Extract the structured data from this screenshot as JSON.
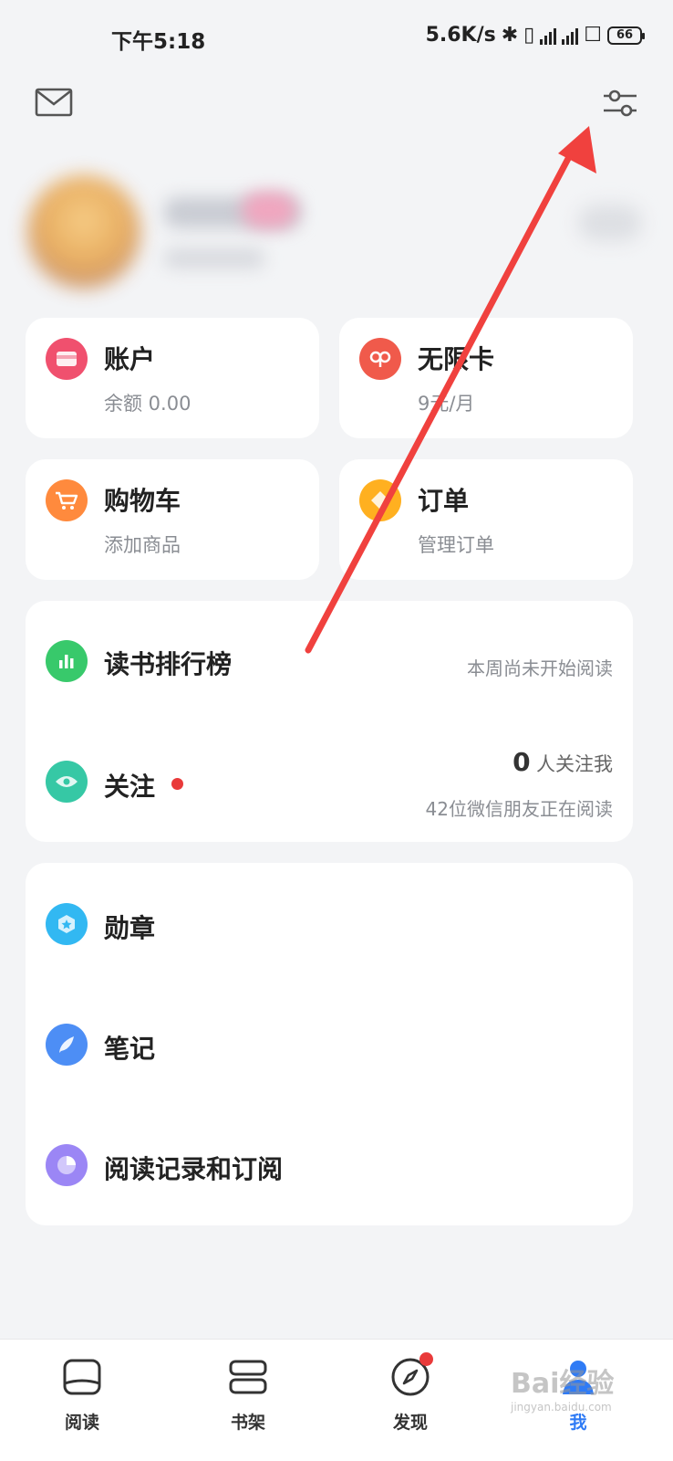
{
  "status_bar": {
    "time": "下午5:18",
    "network_speed": "5.6K/s",
    "battery": "66"
  },
  "header": {
    "mail_icon": "mail-icon",
    "settings_icon": "settings-sliders-icon"
  },
  "cards": {
    "account": {
      "title": "账户",
      "subtitle": "余额 0.00",
      "icon": "wallet-icon",
      "color": "#f0506e"
    },
    "unlimited": {
      "title": "无限卡",
      "subtitle": "9元/月",
      "icon": "infinity-card-icon",
      "color": "#f05a4b"
    },
    "cart": {
      "title": "购物车",
      "subtitle": "添加商品",
      "icon": "cart-icon",
      "color": "#ff8a3d"
    },
    "orders": {
      "title": "订单",
      "subtitle": "管理订单",
      "icon": "order-icon",
      "color": "#ffb020"
    }
  },
  "social": {
    "ranking": {
      "label": "读书排行榜",
      "status": "本周尚未开始阅读",
      "icon": "bar-chart-icon",
      "color": "#38c96b"
    },
    "follow": {
      "label": "关注",
      "count": "0",
      "count_suffix": "人关注我",
      "friends_reading": "42位微信朋友正在阅读",
      "icon": "eye-icon",
      "color": "#36c8a5"
    }
  },
  "menu": {
    "medals": {
      "label": "勋章",
      "icon": "medal-icon",
      "color": "#32b8f2"
    },
    "notes": {
      "label": "笔记",
      "icon": "feather-icon",
      "color": "#4d8ef5"
    },
    "history": {
      "label": "阅读记录和订阅",
      "icon": "history-icon",
      "color": "#9b86f5"
    }
  },
  "tab_bar": {
    "tabs": [
      {
        "label": "阅读",
        "icon": "book-open-icon"
      },
      {
        "label": "书架",
        "icon": "bookshelf-icon"
      },
      {
        "label": "发现",
        "icon": "compass-icon"
      },
      {
        "label": "我",
        "icon": "profile-icon"
      }
    ]
  },
  "watermark": {
    "text": "Bai经验",
    "sub": "jingyan.baidu.com"
  }
}
